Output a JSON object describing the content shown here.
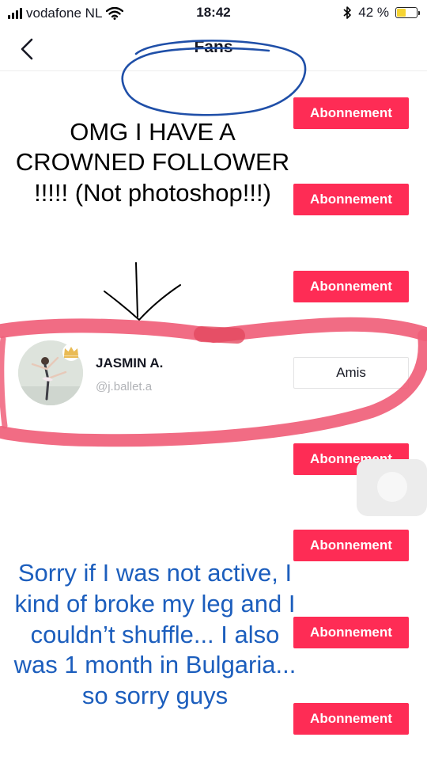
{
  "status_bar": {
    "carrier": "vodafone NL",
    "time": "18:42",
    "battery": "42 %",
    "battery_level": 0.42
  },
  "header": {
    "title": "Fans"
  },
  "follow_label": "Abonnement",
  "friends_label": "Amis",
  "highlighted_user": {
    "name": "JASMIN A.",
    "handle": "@j.ballet.a"
  },
  "overlay": {
    "top_text": "OMG I HAVE A CROWNED FOLLOWER !!!!! (Not photoshop!!!)",
    "bottom_text": "Sorry if I was not active, I kind of broke my leg and I couldn’t shuffle... I also was 1 month in Bulgaria... so sorry guys"
  },
  "colors": {
    "follow_button": "#fe2c55",
    "highlight_marker": "#f0607a",
    "circle_marker": "#1f4fa8",
    "bottom_caption": "#1c5ebd"
  }
}
